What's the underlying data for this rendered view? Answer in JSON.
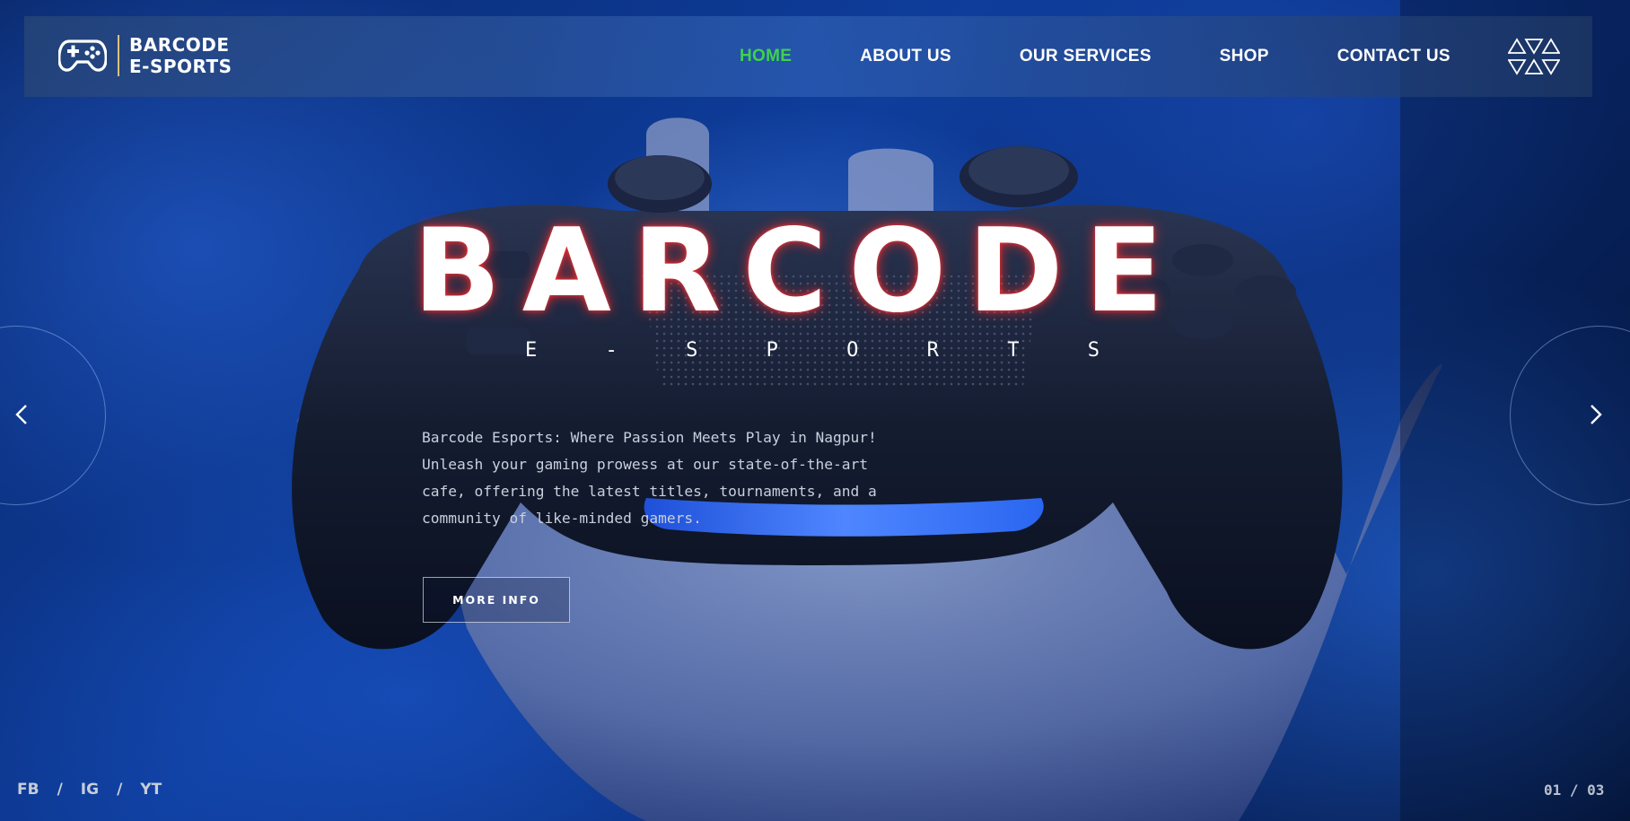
{
  "brand": {
    "line1": "BARCODE",
    "line2": "E-SPORTS"
  },
  "nav": {
    "items": [
      {
        "label": "HOME",
        "active": true
      },
      {
        "label": "ABOUT US",
        "active": false
      },
      {
        "label": "OUR SERVICES",
        "active": false
      },
      {
        "label": "SHOP",
        "active": false
      },
      {
        "label": "CONTACT US",
        "active": false
      }
    ]
  },
  "hero": {
    "title": "BARCODE",
    "subtitle_letters": [
      "E",
      "-",
      "S",
      "P",
      "O",
      "R",
      "T",
      "S"
    ],
    "description": "Barcode Esports: Where Passion Meets Play in Nagpur! Unleash your gaming prowess at our state-of-the-art cafe, offering the latest titles, tournaments, and a community of like-minded gamers.",
    "button_label": "MORE INFO"
  },
  "social": {
    "items": [
      "FB",
      "IG",
      "YT"
    ],
    "separator": "/"
  },
  "slider": {
    "counter": "01 / 03"
  },
  "colors": {
    "accent_active": "#3fd24d",
    "logo_divider": "#d9c27a",
    "title_glow": "#ff2828"
  },
  "icons": {
    "logo": "gamepad-icon",
    "menu": "triangles-menu-icon",
    "prev": "chevron-left-icon",
    "next": "chevron-right-icon"
  }
}
